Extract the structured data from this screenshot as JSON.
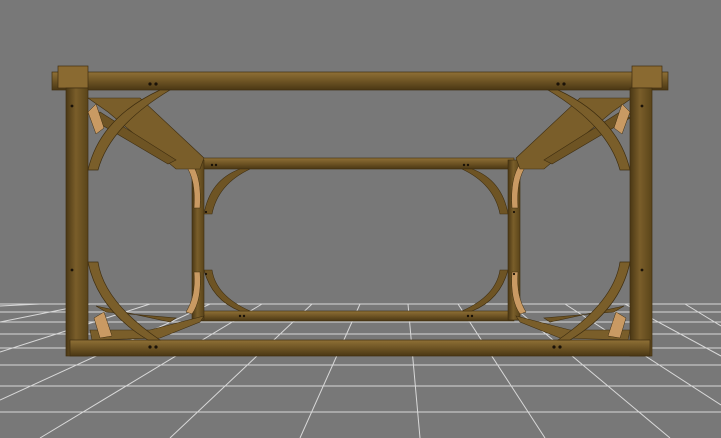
{
  "viewport": {
    "background": "#787878",
    "grid_line_color": "#d8d8d8",
    "content": "3d-timber-frame-model"
  },
  "frame": {
    "timber_color": "#6e5424",
    "timber_light": "#8f7036",
    "timber_dark": "#3f2e10",
    "peg_color": "#1a1208",
    "brace_highlight": "#c99a63"
  }
}
